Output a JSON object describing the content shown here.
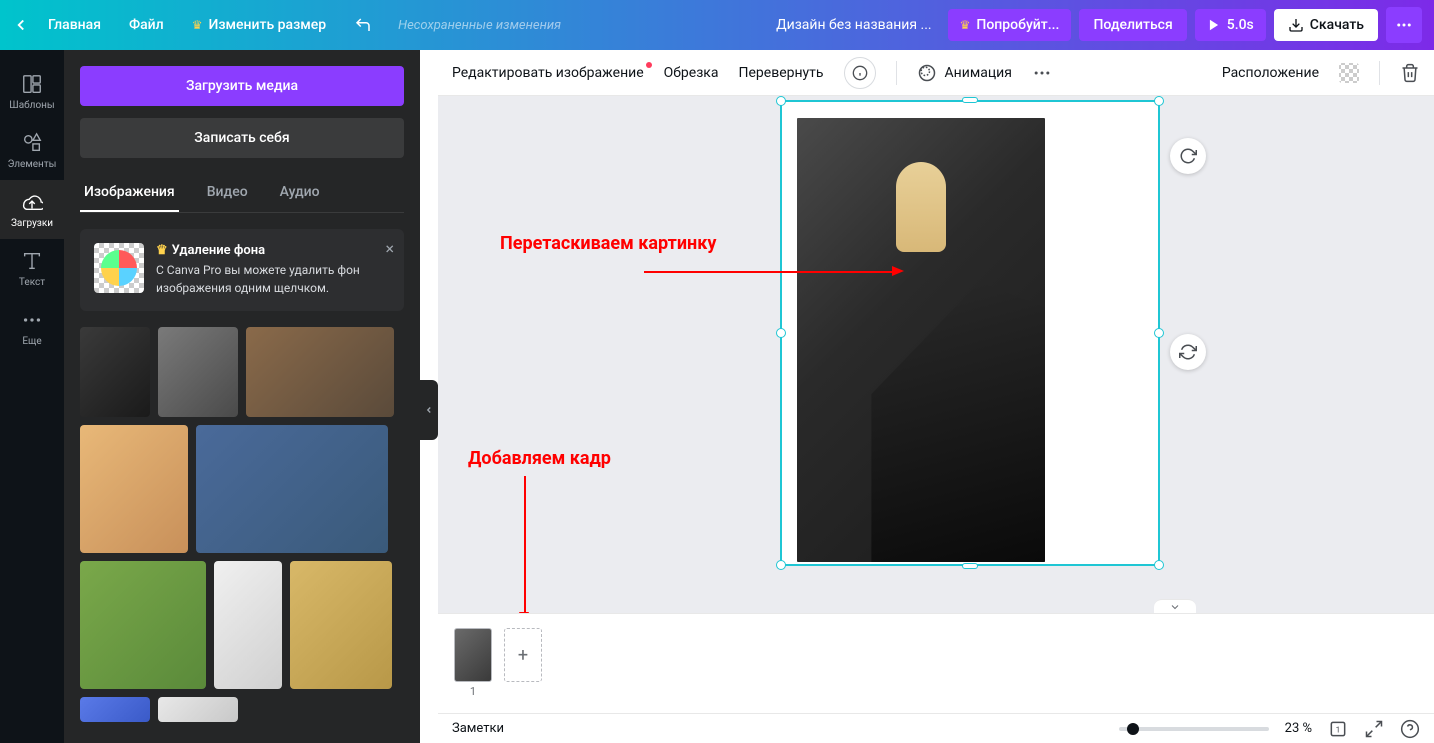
{
  "topbar": {
    "home": "Главная",
    "file": "Файл",
    "resize": "Изменить размер",
    "unsaved": "Несохраненные изменения",
    "title": "Дизайн без названия ...",
    "try": "Попробуйт...",
    "share": "Поделиться",
    "duration": "5.0s",
    "download": "Скачать"
  },
  "rail": {
    "templates": "Шаблоны",
    "elements": "Элементы",
    "uploads": "Загрузки",
    "text": "Текст",
    "more": "Еще"
  },
  "panel": {
    "upload": "Загрузить медиа",
    "record": "Записать себя",
    "tab_images": "Изображения",
    "tab_video": "Видео",
    "tab_audio": "Аудио",
    "promo_title": "Удаление фона",
    "promo_body": "С Canva Pro вы можете удалить фон изображения одним щелчком."
  },
  "canvas_toolbar": {
    "edit_image": "Редактировать изображение",
    "crop": "Обрезка",
    "flip": "Перевернуть",
    "animation": "Анимация",
    "position": "Расположение"
  },
  "annotations": {
    "drag_image": "Перетаскиваем картинку",
    "add_frame": "Добавляем кадр"
  },
  "bottom": {
    "page_number": "1"
  },
  "status": {
    "notes": "Заметки",
    "zoom": "23 %"
  }
}
